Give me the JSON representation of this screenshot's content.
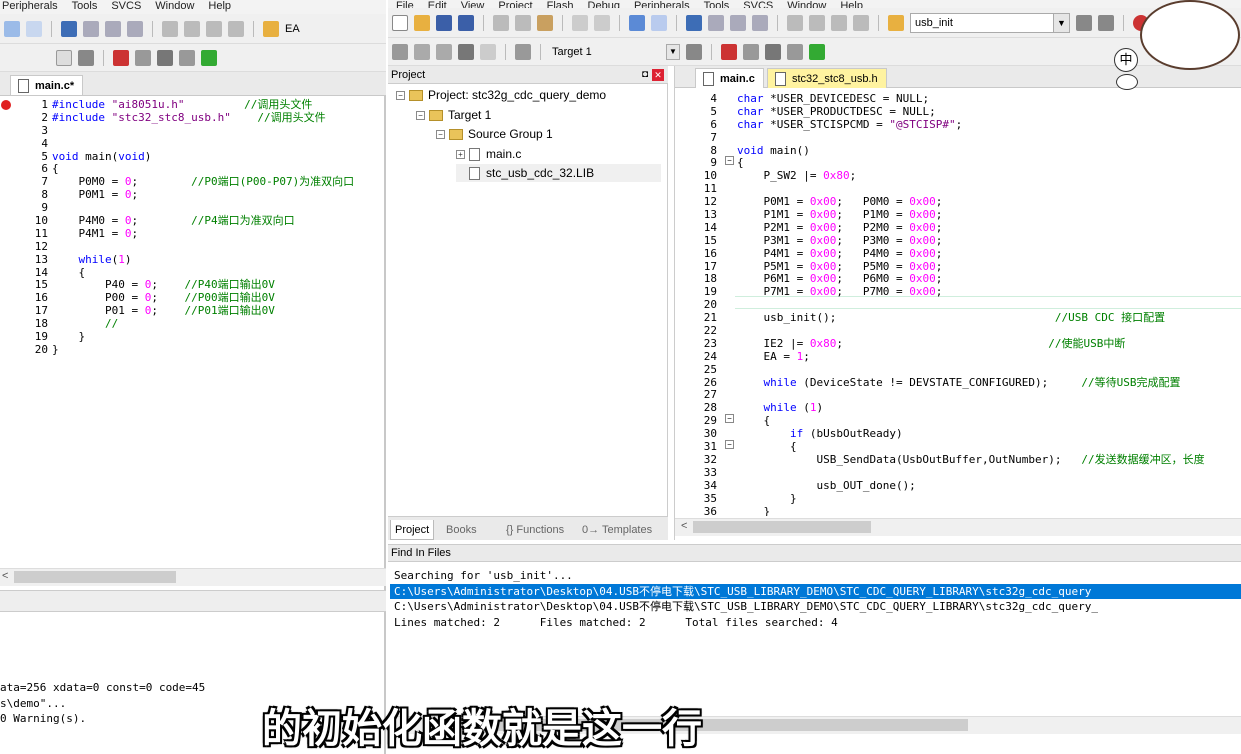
{
  "left_window": {
    "menu": [
      "Peripherals",
      "Tools",
      "SVCS",
      "Window",
      "Help"
    ],
    "toolbar_label": "EA",
    "tab": "main.c*",
    "lines": [
      {
        "n": "1",
        "parts": [
          [
            "pre",
            "#include "
          ],
          [
            "str",
            "\"ai8051u.h\""
          ],
          [
            "txt",
            "         "
          ],
          [
            "cmt",
            "//调用头文件"
          ]
        ]
      },
      {
        "n": "2",
        "parts": [
          [
            "pre",
            "#include "
          ],
          [
            "str",
            "\"stc32_stc8_usb.h\""
          ],
          [
            "txt",
            "    "
          ],
          [
            "cmt",
            "//调用头文件"
          ]
        ]
      },
      {
        "n": "3",
        "parts": []
      },
      {
        "n": "4",
        "parts": []
      },
      {
        "n": "5",
        "parts": [
          [
            "kw",
            "void"
          ],
          [
            "txt",
            " main("
          ],
          [
            "kw",
            "void"
          ],
          [
            "txt",
            ")"
          ]
        ]
      },
      {
        "n": "6",
        "parts": [
          [
            "txt",
            "{"
          ]
        ]
      },
      {
        "n": "7",
        "parts": [
          [
            "txt",
            "    P0M0 = "
          ],
          [
            "num",
            "0"
          ],
          [
            "txt",
            ";        "
          ],
          [
            "cmt",
            "//P0端口(P00-P07)为准双向口"
          ]
        ]
      },
      {
        "n": "8",
        "parts": [
          [
            "txt",
            "    P0M1 = "
          ],
          [
            "num",
            "0"
          ],
          [
            "txt",
            ";"
          ]
        ]
      },
      {
        "n": "9",
        "parts": []
      },
      {
        "n": "10",
        "parts": [
          [
            "txt",
            "    P4M0 = "
          ],
          [
            "num",
            "0"
          ],
          [
            "txt",
            ";        "
          ],
          [
            "cmt",
            "//P4端口为准双向口"
          ]
        ]
      },
      {
        "n": "11",
        "parts": [
          [
            "txt",
            "    P4M1 = "
          ],
          [
            "num",
            "0"
          ],
          [
            "txt",
            ";"
          ]
        ]
      },
      {
        "n": "12",
        "parts": []
      },
      {
        "n": "13",
        "parts": [
          [
            "txt",
            "    "
          ],
          [
            "kw",
            "while"
          ],
          [
            "txt",
            "("
          ],
          [
            "num",
            "1"
          ],
          [
            "txt",
            ")"
          ]
        ]
      },
      {
        "n": "14",
        "parts": [
          [
            "txt",
            "    {"
          ]
        ]
      },
      {
        "n": "15",
        "parts": [
          [
            "txt",
            "        P40 = "
          ],
          [
            "num",
            "0"
          ],
          [
            "txt",
            ";    "
          ],
          [
            "cmt",
            "//P40端口输出0V"
          ]
        ]
      },
      {
        "n": "16",
        "parts": [
          [
            "txt",
            "        P00 = "
          ],
          [
            "num",
            "0"
          ],
          [
            "txt",
            ";    "
          ],
          [
            "cmt",
            "//P00端口输出0V"
          ]
        ]
      },
      {
        "n": "17",
        "parts": [
          [
            "txt",
            "        P01 = "
          ],
          [
            "num",
            "0"
          ],
          [
            "txt",
            ";    "
          ],
          [
            "cmt",
            "//P01端口输出0V"
          ]
        ]
      },
      {
        "n": "18",
        "parts": [
          [
            "txt",
            "        "
          ],
          [
            "cmt",
            "//"
          ]
        ]
      },
      {
        "n": "19",
        "parts": [
          [
            "txt",
            "    }"
          ]
        ]
      },
      {
        "n": "20",
        "parts": [
          [
            "txt",
            "}"
          ]
        ]
      }
    ],
    "build_output": [
      "ata=256 xdata=0 const=0 code=45",
      "s\\demo\"...",
      "0 Warning(s)."
    ]
  },
  "right_window": {
    "menu": [
      "File",
      "Edit",
      "View",
      "Project",
      "Flash",
      "Debug",
      "Peripherals",
      "Tools",
      "SVCS",
      "Window",
      "Help"
    ],
    "toolbar_target": "usb_init",
    "toolbar_target2": "Target 1",
    "project_panel": {
      "title": "Project",
      "tree": [
        {
          "label": "Project: stc32g_cdc_query_demo",
          "indent": 0,
          "toggle": "-",
          "icon": "project"
        },
        {
          "label": "Target 1",
          "indent": 1,
          "toggle": "-",
          "icon": "folder"
        },
        {
          "label": "Source Group 1",
          "indent": 2,
          "toggle": "-",
          "icon": "folder"
        },
        {
          "label": "main.c",
          "indent": 3,
          "toggle": "+",
          "icon": "file"
        },
        {
          "label": "stc_usb_cdc_32.LIB",
          "indent": 3,
          "toggle": "",
          "icon": "file"
        }
      ],
      "bottom_tabs": [
        "Project",
        "Books",
        "{} Functions",
        "0→ Templates"
      ]
    },
    "editor_tabs": [
      "main.c",
      "stc32_stc8_usb.h"
    ],
    "lines": [
      {
        "n": "4",
        "parts": [
          [
            "kw",
            "char"
          ],
          [
            "txt",
            " *USER_DEVICEDESC = NULL;"
          ]
        ]
      },
      {
        "n": "5",
        "parts": [
          [
            "kw",
            "char"
          ],
          [
            "txt",
            " *USER_PRODUCTDESC = NULL;"
          ]
        ]
      },
      {
        "n": "6",
        "parts": [
          [
            "kw",
            "char"
          ],
          [
            "txt",
            " *USER_STCISPCMD = "
          ],
          [
            "str",
            "\"@STCISP#\""
          ],
          [
            "txt",
            ";"
          ]
        ]
      },
      {
        "n": "7",
        "parts": []
      },
      {
        "n": "8",
        "parts": [
          [
            "kw",
            "void"
          ],
          [
            "txt",
            " main()"
          ]
        ]
      },
      {
        "n": "9",
        "parts": [
          [
            "txt",
            "{"
          ]
        ]
      },
      {
        "n": "10",
        "parts": [
          [
            "txt",
            "    P_SW2 |= "
          ],
          [
            "num",
            "0x80"
          ],
          [
            "txt",
            ";"
          ]
        ]
      },
      {
        "n": "11",
        "parts": []
      },
      {
        "n": "12",
        "parts": [
          [
            "txt",
            "    P0M1 = "
          ],
          [
            "num",
            "0x00"
          ],
          [
            "txt",
            ";   P0M0 = "
          ],
          [
            "num",
            "0x00"
          ],
          [
            "txt",
            ";"
          ]
        ]
      },
      {
        "n": "13",
        "parts": [
          [
            "txt",
            "    P1M1 = "
          ],
          [
            "num",
            "0x00"
          ],
          [
            "txt",
            ";   P1M0 = "
          ],
          [
            "num",
            "0x00"
          ],
          [
            "txt",
            ";"
          ]
        ]
      },
      {
        "n": "14",
        "parts": [
          [
            "txt",
            "    P2M1 = "
          ],
          [
            "num",
            "0x00"
          ],
          [
            "txt",
            ";   P2M0 = "
          ],
          [
            "num",
            "0x00"
          ],
          [
            "txt",
            ";"
          ]
        ]
      },
      {
        "n": "15",
        "parts": [
          [
            "txt",
            "    P3M1 = "
          ],
          [
            "num",
            "0x00"
          ],
          [
            "txt",
            ";   P3M0 = "
          ],
          [
            "num",
            "0x00"
          ],
          [
            "txt",
            ";"
          ]
        ]
      },
      {
        "n": "16",
        "parts": [
          [
            "txt",
            "    P4M1 = "
          ],
          [
            "num",
            "0x00"
          ],
          [
            "txt",
            ";   P4M0 = "
          ],
          [
            "num",
            "0x00"
          ],
          [
            "txt",
            ";"
          ]
        ]
      },
      {
        "n": "17",
        "parts": [
          [
            "txt",
            "    P5M1 = "
          ],
          [
            "num",
            "0x00"
          ],
          [
            "txt",
            ";   P5M0 = "
          ],
          [
            "num",
            "0x00"
          ],
          [
            "txt",
            ";"
          ]
        ]
      },
      {
        "n": "18",
        "parts": [
          [
            "txt",
            "    P6M1 = "
          ],
          [
            "num",
            "0x00"
          ],
          [
            "txt",
            ";   P6M0 = "
          ],
          [
            "num",
            "0x00"
          ],
          [
            "txt",
            ";"
          ]
        ]
      },
      {
        "n": "19",
        "parts": [
          [
            "txt",
            "    P7M1 = "
          ],
          [
            "num",
            "0x00"
          ],
          [
            "txt",
            ";   P7M0 = "
          ],
          [
            "num",
            "0x00"
          ],
          [
            "txt",
            ";"
          ]
        ]
      },
      {
        "n": "20",
        "parts": []
      },
      {
        "n": "21",
        "parts": [
          [
            "txt",
            "    usb_init();                                 "
          ],
          [
            "cmt",
            "//USB CDC 接口配置"
          ]
        ]
      },
      {
        "n": "22",
        "parts": []
      },
      {
        "n": "23",
        "parts": [
          [
            "txt",
            "    IE2 |= "
          ],
          [
            "num",
            "0x80"
          ],
          [
            "txt",
            ";                               "
          ],
          [
            "cmt",
            "//使能USB中断"
          ]
        ]
      },
      {
        "n": "24",
        "parts": [
          [
            "txt",
            "    EA = "
          ],
          [
            "num",
            "1"
          ],
          [
            "txt",
            ";"
          ]
        ]
      },
      {
        "n": "25",
        "parts": []
      },
      {
        "n": "26",
        "parts": [
          [
            "txt",
            "    "
          ],
          [
            "kw",
            "while"
          ],
          [
            "txt",
            " (DeviceState != DEVSTATE_CONFIGURED);     "
          ],
          [
            "cmt",
            "//等待USB完成配置"
          ]
        ]
      },
      {
        "n": "27",
        "parts": []
      },
      {
        "n": "28",
        "parts": [
          [
            "txt",
            "    "
          ],
          [
            "kw",
            "while"
          ],
          [
            "txt",
            " ("
          ],
          [
            "num",
            "1"
          ],
          [
            "txt",
            ")"
          ]
        ]
      },
      {
        "n": "29",
        "parts": [
          [
            "txt",
            "    {"
          ]
        ]
      },
      {
        "n": "30",
        "parts": [
          [
            "txt",
            "        "
          ],
          [
            "kw",
            "if"
          ],
          [
            "txt",
            " (bUsbOutReady)"
          ]
        ]
      },
      {
        "n": "31",
        "parts": [
          [
            "txt",
            "        {"
          ]
        ]
      },
      {
        "n": "32",
        "parts": [
          [
            "txt",
            "            USB_SendData(UsbOutBuffer,OutNumber);   "
          ],
          [
            "cmt",
            "//发送数据缓冲区，长度"
          ]
        ]
      },
      {
        "n": "33",
        "parts": []
      },
      {
        "n": "34",
        "parts": [
          [
            "txt",
            "            usb_OUT_done();"
          ]
        ]
      },
      {
        "n": "35",
        "parts": [
          [
            "txt",
            "        }"
          ]
        ]
      },
      {
        "n": "36",
        "parts": [
          [
            "txt",
            "    }"
          ]
        ]
      }
    ],
    "find_panel": {
      "title": "Find In Files",
      "lines": [
        "Searching for 'usb_init'...",
        "C:\\Users\\Administrator\\Desktop\\04.USB不停电下载\\STC_USB_LIBRARY_DEMO\\STC_CDC_QUERY_LIBRARY\\stc32g_cdc_query",
        "C:\\Users\\Administrator\\Desktop\\04.USB不停电下载\\STC_USB_LIBRARY_DEMO\\STC_CDC_QUERY_LIBRARY\\stc32g_cdc_query_",
        "Lines matched: 2      Files matched: 2      Total files searched: 4"
      ],
      "selected_index": 1
    }
  },
  "ime_indicator": "中",
  "subtitle": "的初始化函数就是这一行",
  "colors": {
    "keyword": "#0000ff",
    "number": "#ff00ff",
    "string": "#800080",
    "comment": "#008000",
    "selection": "#0078d7"
  }
}
